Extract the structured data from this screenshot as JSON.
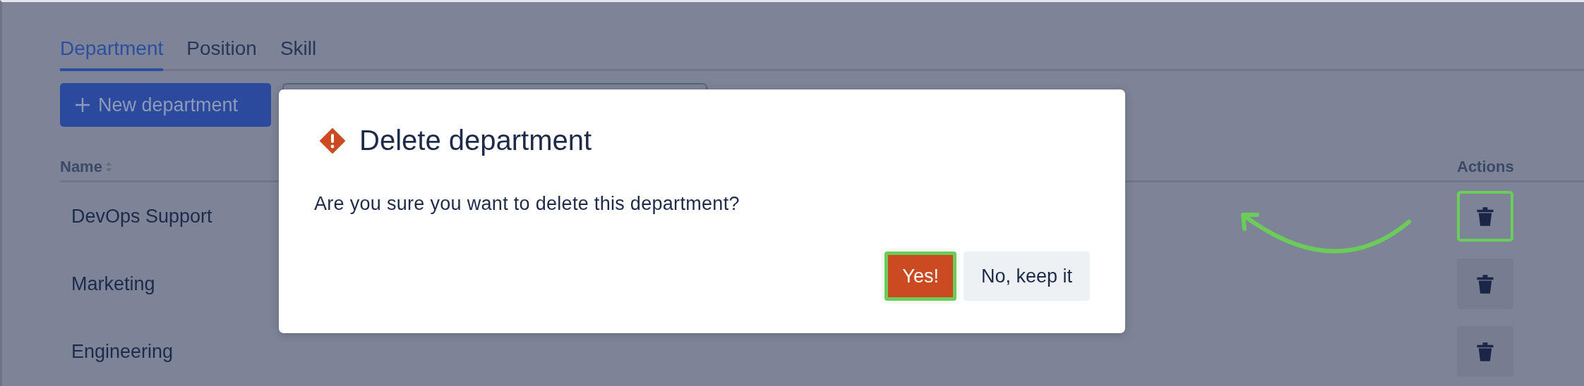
{
  "tabs": [
    {
      "label": "Department",
      "selected": true
    },
    {
      "label": "Position",
      "selected": false
    },
    {
      "label": "Skill",
      "selected": false
    }
  ],
  "toolbar": {
    "new_button": "New department"
  },
  "table": {
    "columns": [
      {
        "label": "Name",
        "sortable": true
      },
      {
        "label": "Actions",
        "sortable": false
      }
    ],
    "rows": [
      {
        "name": "DevOps Support",
        "highlighted": true
      },
      {
        "name": "Marketing",
        "highlighted": false
      },
      {
        "name": "Engineering",
        "highlighted": false
      }
    ]
  },
  "dialog": {
    "title": "Delete department",
    "message": "Are you sure you want to delete this department?",
    "buttons": [
      {
        "label": "Yes!",
        "kind": "danger",
        "highlighted": true
      },
      {
        "label": "No, keep it",
        "kind": "secondary",
        "highlighted": false
      }
    ]
  }
}
